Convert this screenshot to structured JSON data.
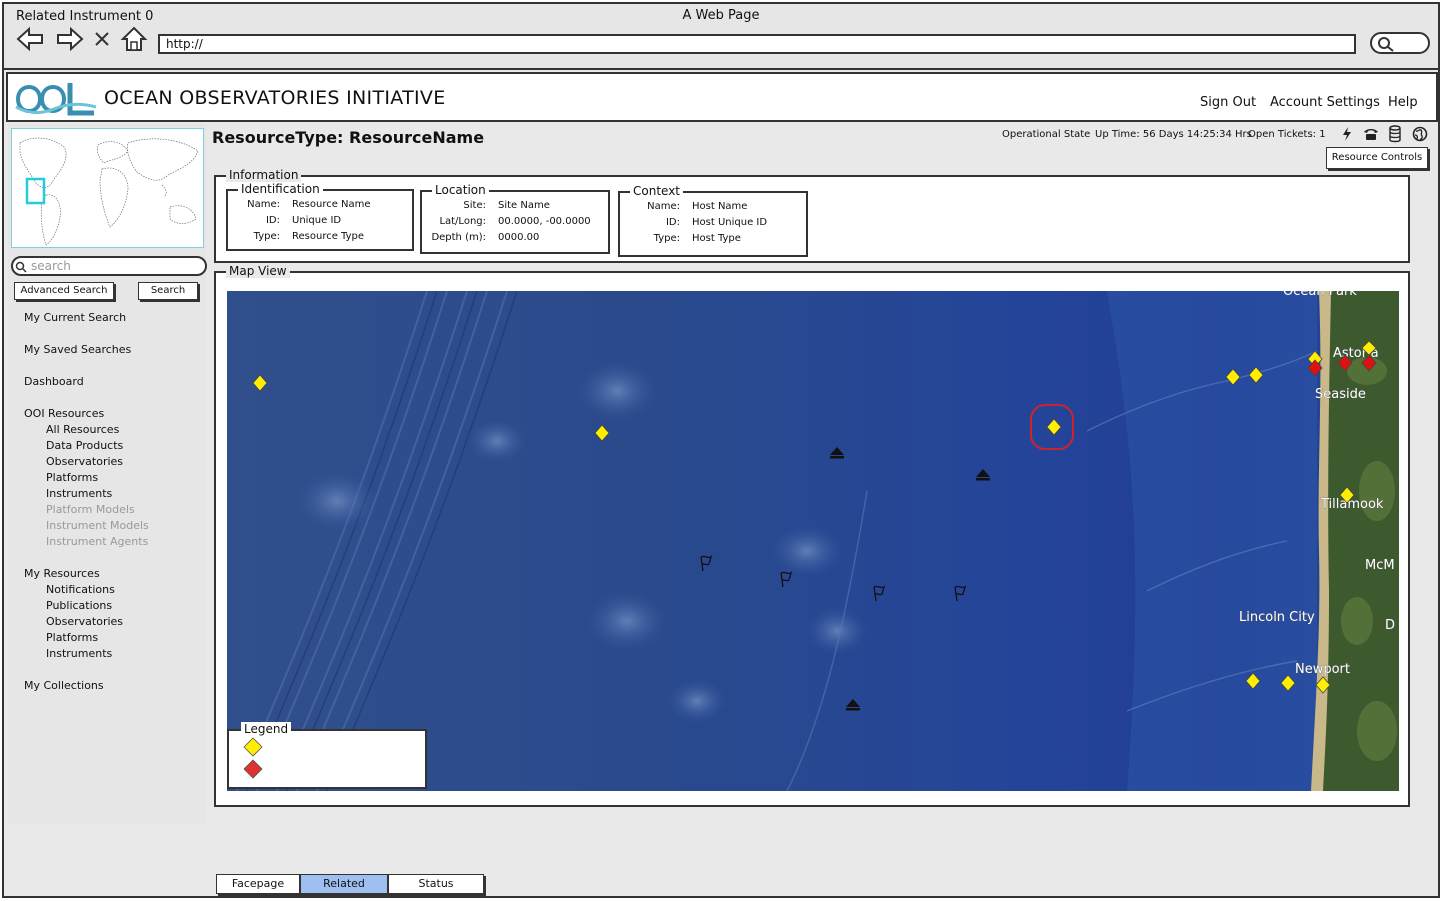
{
  "window": {
    "title": "Related Instrument 0",
    "page_title": "A Web Page",
    "url": "http://"
  },
  "header": {
    "brand": "OCEAN OBSERVATORIES INITIATIVE",
    "links": [
      "Sign Out",
      "Account Settings",
      "Help"
    ]
  },
  "sidebar": {
    "search_placeholder": "search",
    "advanced_search_label": "Advanced Search",
    "search_label": "Search",
    "my_current_search": "My Current Search",
    "my_saved_searches": "My Saved Searches",
    "dashboard": "Dashboard",
    "ooi_resources": {
      "label": "OOI Resources",
      "items": [
        "All Resources",
        "Data Products",
        "Observatories",
        "Platforms",
        "Instruments",
        "Platform Models",
        "Instrument Models",
        "Instrument Agents"
      ]
    },
    "my_resources": {
      "label": "My Resources",
      "items": [
        "Notifications",
        "Publications",
        "Observatories",
        "Platforms",
        "Instruments"
      ]
    },
    "my_collections": "My Collections"
  },
  "main": {
    "title": "ResourceType: ResourceName",
    "status": {
      "operational": "Operational State",
      "uptime": "Up Time: 56 Days 14:25:34 Hrs",
      "tickets": "Open Tickets: 1"
    },
    "resource_controls_label": "Resource Controls",
    "information": {
      "legend": "Information",
      "identification": {
        "legend": "Identification",
        "name_label": "Name:",
        "name_value": "Resource Name",
        "id_label": "ID:",
        "id_value": "Unique ID",
        "type_label": "Type:",
        "type_value": "Resource Type"
      },
      "location": {
        "legend": "Location",
        "site_label": "Site:",
        "site_value": "Site Name",
        "latlong_label": "Lat/Long:",
        "latlong_value": "00.0000, -00.0000",
        "depth_label": "Depth (m):",
        "depth_value": "0000.00"
      },
      "context": {
        "legend": "Context",
        "name_label": "Name:",
        "name_value": "Host Name",
        "id_label": "ID:",
        "id_value": "Host Unique ID",
        "type_label": "Type:",
        "type_value": "Host Type"
      }
    },
    "map_view": {
      "legend": "Map View",
      "place_labels": [
        "Ocean Park",
        "Astoria",
        "Seaside",
        "Tillamook",
        "McM",
        "Lincoln City",
        "Newport",
        "D"
      ],
      "legend_box_label": "Legend"
    }
  },
  "tabs": [
    "Facepage",
    "Related",
    "Status"
  ],
  "colors": {
    "yellow_marker": "#ffee00",
    "red_marker": "#dd1111",
    "active_tab": "#9fbff0",
    "ocean": "#2a4a8a"
  }
}
